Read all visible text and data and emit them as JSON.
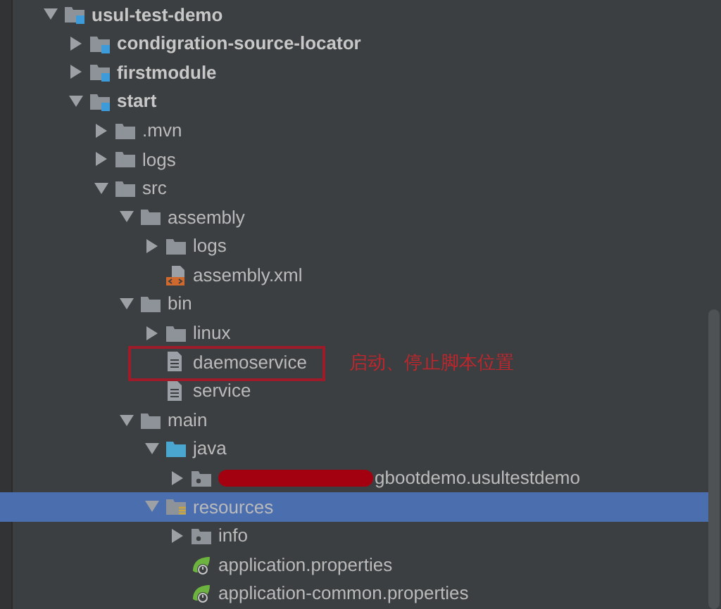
{
  "tree": [
    {
      "label": "usul-test-demo",
      "kind": "module",
      "expanded": true,
      "selected": false,
      "children": [
        {
          "label": "condigration-source-locator",
          "kind": "module",
          "expanded": false,
          "selected": false
        },
        {
          "label": "firstmodule",
          "kind": "module",
          "expanded": false,
          "selected": false
        },
        {
          "label": "start",
          "kind": "module",
          "expanded": true,
          "selected": false,
          "children": [
            {
              "label": ".mvn",
              "kind": "folder",
              "expanded": false,
              "selected": false
            },
            {
              "label": "logs",
              "kind": "folder",
              "expanded": false,
              "selected": false
            },
            {
              "label": "src",
              "kind": "folder",
              "expanded": true,
              "selected": false,
              "children": [
                {
                  "label": "assembly",
                  "kind": "folder",
                  "expanded": true,
                  "selected": false,
                  "children": [
                    {
                      "label": "logs",
                      "kind": "folder",
                      "expanded": false,
                      "selected": false
                    },
                    {
                      "label": "assembly.xml",
                      "kind": "xml",
                      "selected": false
                    }
                  ]
                },
                {
                  "label": "bin",
                  "kind": "folder",
                  "expanded": true,
                  "selected": false,
                  "children": [
                    {
                      "label": "linux",
                      "kind": "folder",
                      "expanded": false,
                      "selected": false
                    },
                    {
                      "label": "daemoservice",
                      "kind": "file",
                      "selected": false,
                      "annotated": true
                    },
                    {
                      "label": "service",
                      "kind": "file",
                      "selected": false
                    }
                  ]
                },
                {
                  "label": "main",
                  "kind": "folder",
                  "expanded": true,
                  "selected": false,
                  "children": [
                    {
                      "label": "java",
                      "kind": "source",
                      "expanded": true,
                      "selected": false,
                      "children": [
                        {
                          "label": "gbootdemo.usultestdemo",
                          "kind": "package",
                          "expanded": false,
                          "selected": false,
                          "redacted": true
                        }
                      ]
                    },
                    {
                      "label": "resources",
                      "kind": "resources",
                      "expanded": true,
                      "selected": true,
                      "children": [
                        {
                          "label": "info",
                          "kind": "package",
                          "expanded": false,
                          "selected": false
                        },
                        {
                          "label": "application.properties",
                          "kind": "spring",
                          "selected": false
                        },
                        {
                          "label": "application-common.properties",
                          "kind": "spring",
                          "selected": false
                        }
                      ]
                    }
                  ]
                }
              ]
            }
          ]
        }
      ]
    }
  ],
  "annotation": {
    "text": "启动、停止脚本位置"
  }
}
